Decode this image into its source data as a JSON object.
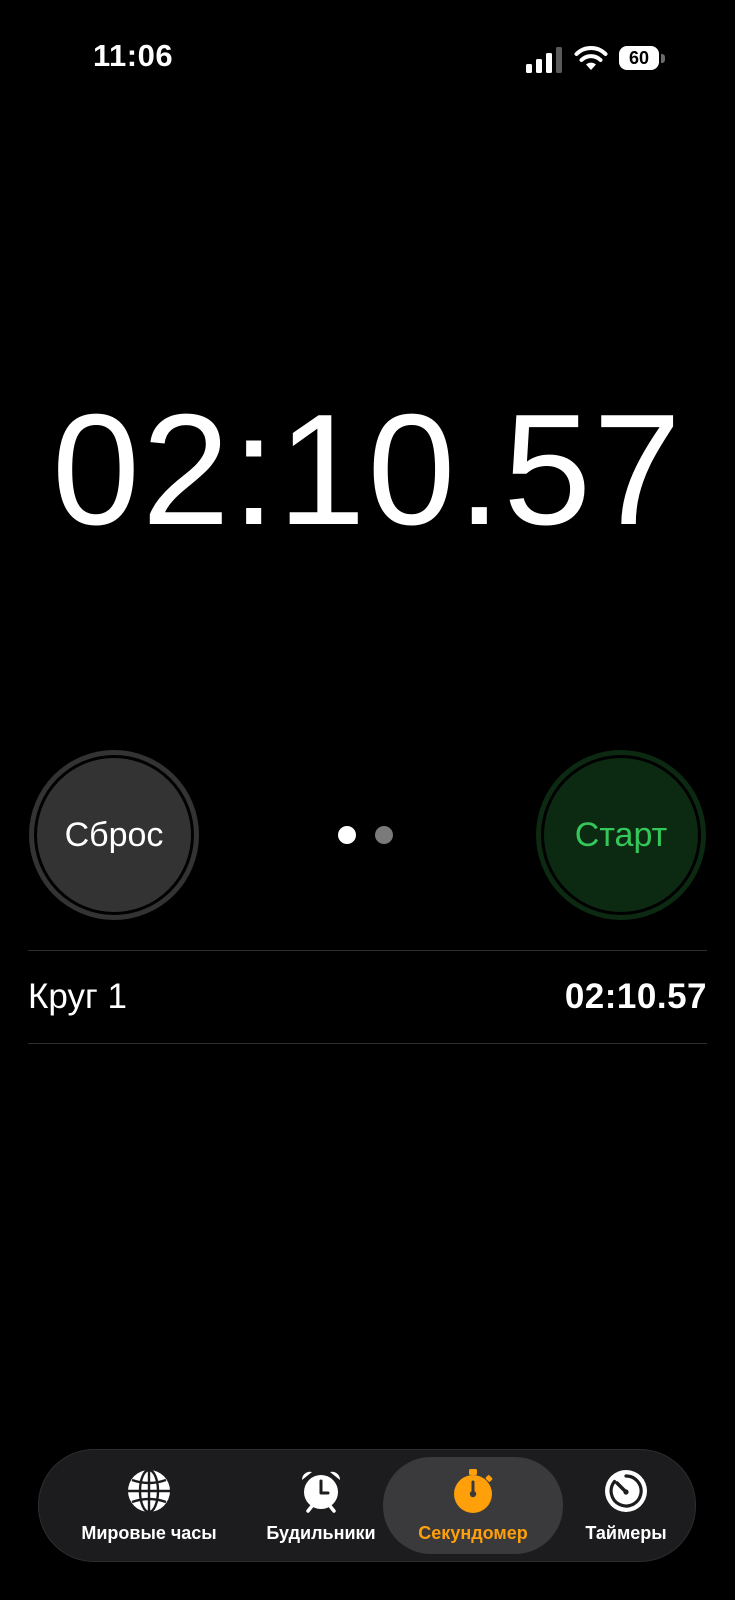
{
  "status_bar": {
    "time": "11:06",
    "battery_level": "60"
  },
  "stopwatch": {
    "main_time": "02:10.57",
    "reset_label": "Сброс",
    "start_label": "Старт",
    "page_dots": {
      "count": 2,
      "active_index": 0
    }
  },
  "laps": [
    {
      "label": "Круг 1",
      "time": "02:10.57"
    }
  ],
  "tab_bar": {
    "tabs": [
      {
        "label": "Мировые часы",
        "icon": "globe-icon",
        "selected": false
      },
      {
        "label": "Будильники",
        "icon": "alarm-clock-icon",
        "selected": false
      },
      {
        "label": "Секундомер",
        "icon": "stopwatch-icon",
        "selected": true
      },
      {
        "label": "Таймеры",
        "icon": "timer-icon",
        "selected": false
      }
    ]
  },
  "colors": {
    "background": "#000000",
    "accent": "#ff9f0a",
    "start_text": "#34c759",
    "start_button": "#0c2a12",
    "reset_button": "#333333",
    "tab_bar": "#1c1c1e"
  }
}
